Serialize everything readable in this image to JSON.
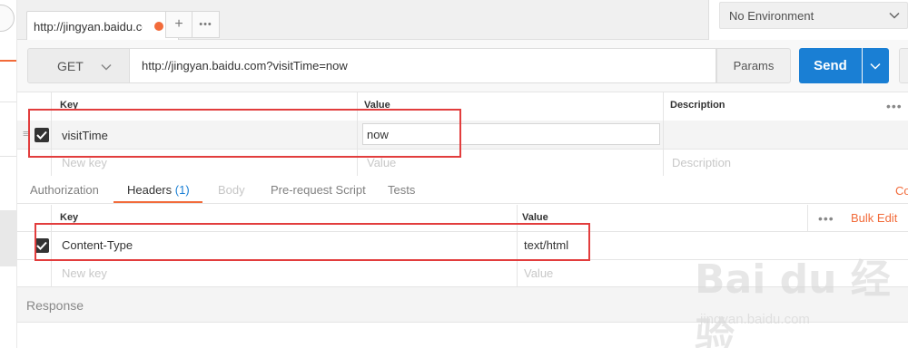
{
  "tab": {
    "title": "http://jingyan.baidu.com"
  },
  "tab_buttons": {
    "add": "+",
    "more": "•••"
  },
  "environment": {
    "selected": "No Environment"
  },
  "request": {
    "method": "GET",
    "url": "http://jingyan.baidu.com?visitTime=now",
    "params_label": "Params",
    "send_label": "Send"
  },
  "params_table": {
    "headers": {
      "key": "Key",
      "value": "Value",
      "description": "Description"
    },
    "rows": [
      {
        "key": "visitTime",
        "value": "now",
        "checked": true
      }
    ],
    "placeholder": {
      "key": "New key",
      "value": "Value",
      "description": "Description"
    }
  },
  "sub_tabs": {
    "authorization": "Authorization",
    "headers": "Headers",
    "headers_count": "(1)",
    "body": "Body",
    "prerequest": "Pre-request Script",
    "tests": "Tests",
    "cookies": "Co"
  },
  "headers_table": {
    "headers": {
      "key": "Key",
      "value": "Value"
    },
    "bulk_edit": "Bulk Edit",
    "rows": [
      {
        "key": "Content-Type",
        "value": "text/html",
        "checked": true
      }
    ],
    "placeholder": {
      "key": "New key",
      "value": "Value"
    }
  },
  "response": {
    "label": "Response"
  },
  "watermark": {
    "logo": "Bai du 经验",
    "url": "jingyan.baidu.com"
  },
  "colors": {
    "accent": "#f26b3a",
    "send": "#1a7fd4",
    "annotation": "#e23d3d"
  }
}
